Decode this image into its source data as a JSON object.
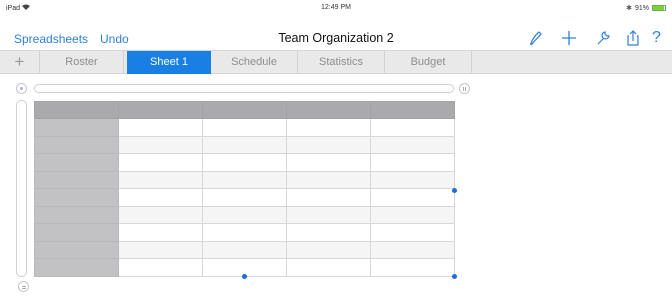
{
  "status_bar": {
    "device": "iPad",
    "time": "12:49 PM",
    "battery_text": "91%",
    "battery_level": 0.91
  },
  "nav": {
    "spreadsheets_label": "Spreadsheets",
    "undo_label": "Undo",
    "title": "Team Organization 2",
    "icons": [
      "format-brush-icon",
      "plus-icon",
      "wrench-icon",
      "share-icon",
      "help-icon"
    ],
    "help_glyph": "?"
  },
  "tabs": {
    "add_glyph": "+",
    "items": [
      {
        "label": "Roster",
        "active": false
      },
      {
        "label": "Sheet 1",
        "active": true
      },
      {
        "label": "Schedule",
        "active": false
      },
      {
        "label": "Statistics",
        "active": false
      },
      {
        "label": "Budget",
        "active": false
      }
    ]
  },
  "colors": {
    "accent": "#2f80d8",
    "active_tab": "#1a7fe4",
    "header_row": "#aaaaad",
    "header_column": "#c2c2c4"
  },
  "table": {
    "columns": 5,
    "rows": 10,
    "header_rows": 1,
    "header_columns": 1,
    "cells": []
  }
}
